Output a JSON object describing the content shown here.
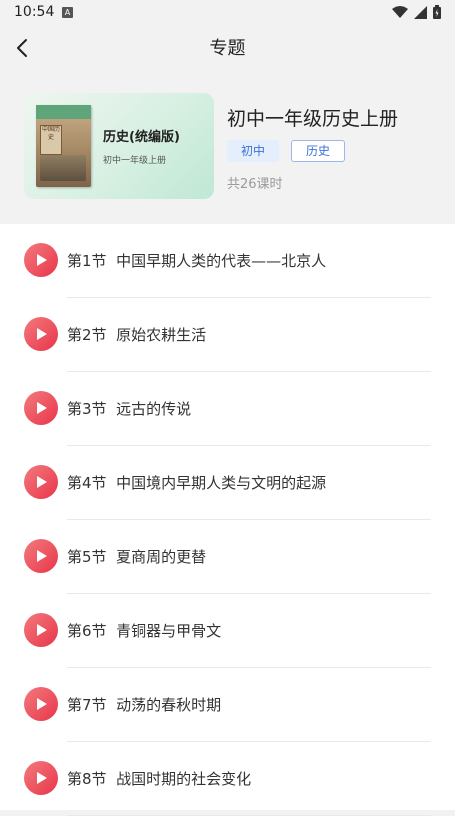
{
  "status_bar": {
    "time": "10:54",
    "notif_badge": "A"
  },
  "nav": {
    "title": "专题"
  },
  "cover": {
    "title": "历史(统编版)",
    "subtitle": "初中一年级上册",
    "book_seal": "中国历史"
  },
  "course": {
    "title": "初中一年级历史上册",
    "tags": [
      "初中",
      "历史"
    ],
    "lesson_count": "共26课时"
  },
  "lessons": [
    {
      "number": "第1节",
      "title": "中国早期人类的代表——北京人"
    },
    {
      "number": "第2节",
      "title": "原始农耕生活"
    },
    {
      "number": "第3节",
      "title": "远古的传说"
    },
    {
      "number": "第4节",
      "title": "中国境内早期人类与文明的起源"
    },
    {
      "number": "第5节",
      "title": "夏商周的更替"
    },
    {
      "number": "第6节",
      "title": "青铜器与甲骨文"
    },
    {
      "number": "第7节",
      "title": "动荡的春秋时期"
    },
    {
      "number": "第8节",
      "title": "战国时期的社会变化"
    }
  ],
  "colors": {
    "accent": "#e8354a",
    "tag_blue": "#3a72d8",
    "hero_bg": "#f2f2f2"
  }
}
